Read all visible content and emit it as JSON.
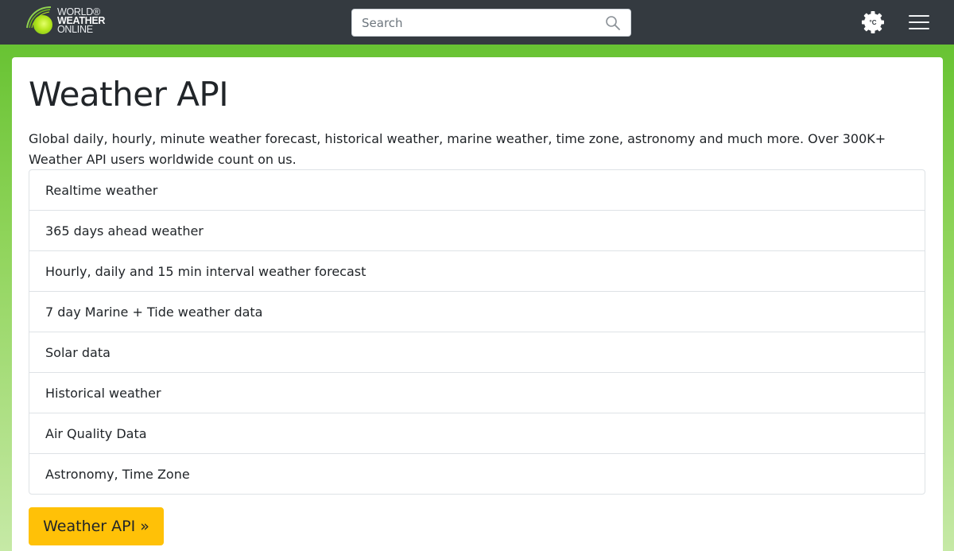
{
  "header": {
    "logo": {
      "line1": "WORLD®",
      "line2": "WEATHER",
      "line3": "ONLINE"
    },
    "search": {
      "placeholder": "Search",
      "value": "",
      "icon": "search-icon"
    },
    "unit_toggle": {
      "label": "°C",
      "icon": "gear-icon"
    },
    "menu": {
      "icon": "hamburger-menu-icon"
    }
  },
  "main": {
    "title": "Weather API",
    "description": "Global daily, hourly, minute weather forecast, historical weather, marine weather, time zone, astronomy and much more. Over 300K+ Weather API users worldwide count on us.",
    "features": [
      "Realtime weather",
      "365 days ahead weather",
      "Hourly, daily and 15 min interval weather forecast",
      "7 day Marine + Tide weather data",
      "Solar data",
      "Historical weather",
      "Air Quality Data",
      "Astronomy, Time Zone"
    ],
    "cta_label": "Weather API »"
  },
  "colors": {
    "header_bg": "#343a40",
    "accent_green": "#5fbf2a",
    "button_yellow": "#ffc107",
    "card_bg": "#ffffff"
  }
}
